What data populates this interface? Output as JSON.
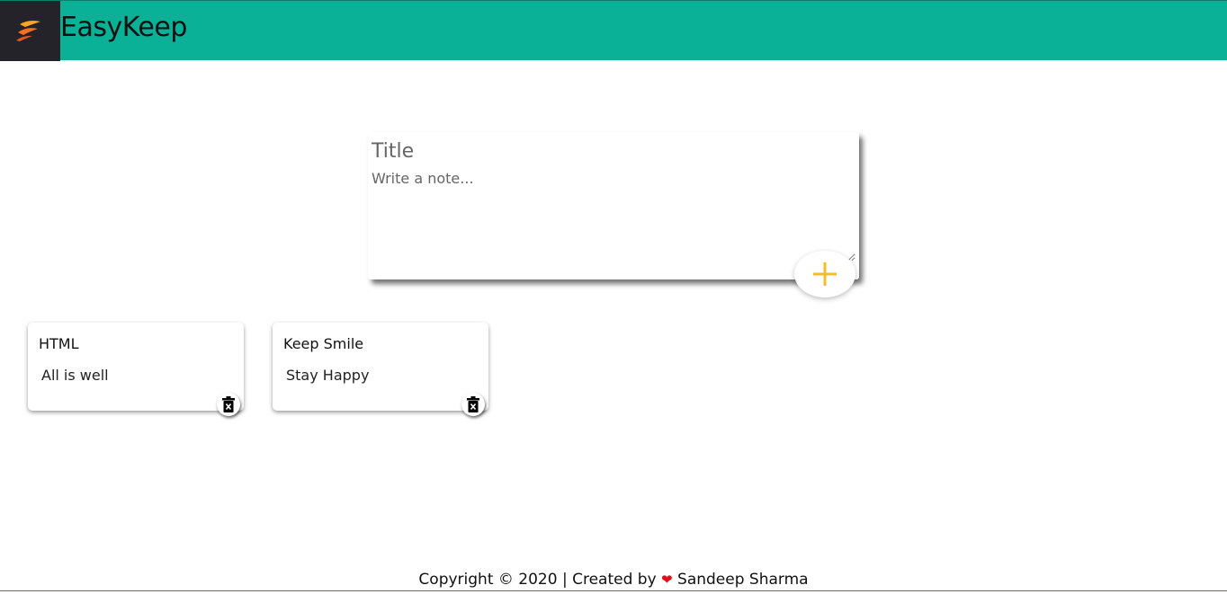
{
  "header": {
    "app_title": "EasyKeep",
    "logo_icon": "flame-logo-icon",
    "background_color": "#0ab196",
    "logo_bg_color": "#24232a"
  },
  "composer": {
    "title_placeholder": "Title",
    "note_placeholder": "Write a note...",
    "add_icon": "plus-icon",
    "accent_color": "#f6bd2a"
  },
  "notes": [
    {
      "title": "HTML",
      "body": "All is well",
      "delete_icon": "trash-icon"
    },
    {
      "title": "Keep Smile",
      "body": "Stay Happy",
      "delete_icon": "trash-icon"
    }
  ],
  "footer": {
    "prefix": "Copyright © 2020 | Created by",
    "heart": "❤",
    "author": "Sandeep Sharma"
  }
}
